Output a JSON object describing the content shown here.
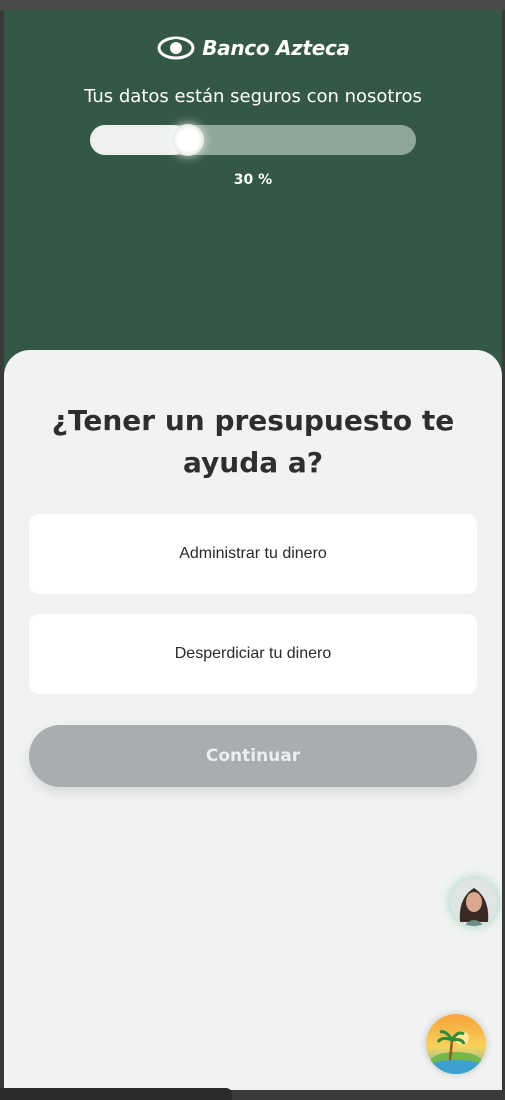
{
  "brand": {
    "name": "Banco Azteca",
    "logo_icon": "banco-azteca-eye-logo"
  },
  "header": {
    "subtitle": "Tus datos están seguros con nosotros",
    "progress": {
      "value_percent": 30,
      "label": "30 %"
    }
  },
  "question": {
    "text": "¿Tener un presupuesto te ayuda a?"
  },
  "options": [
    {
      "label": "Administrar tu dinero"
    },
    {
      "label": "Desperdiciar tu dinero"
    }
  ],
  "actions": {
    "continue_label": "Continuar",
    "continue_enabled": false
  },
  "floating": {
    "assistant_icon": "assistant-avatar",
    "beach_icon": "beach-island-icon"
  },
  "colors": {
    "header_bg": "#345746",
    "card_bg": "#f1f3f2",
    "button_disabled": "#a8adb0",
    "progress_track": "#8ea798",
    "progress_fill": "#eef1ee"
  }
}
